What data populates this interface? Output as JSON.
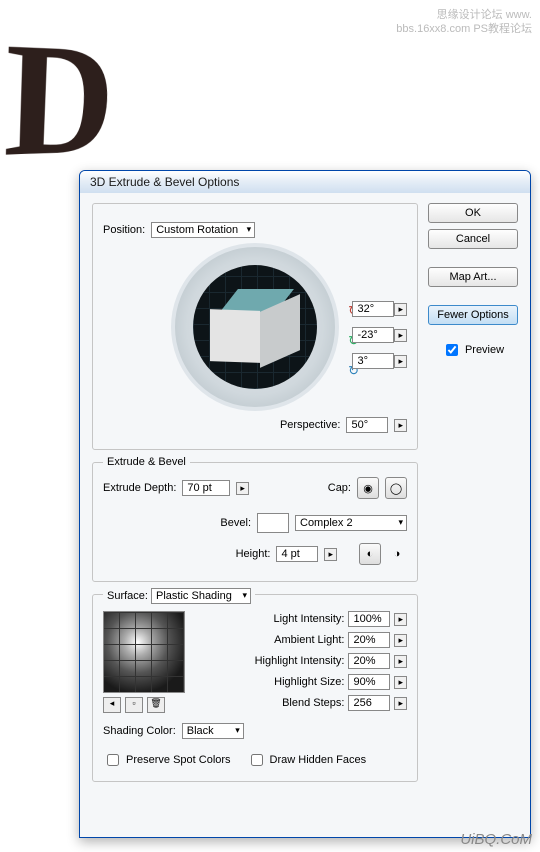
{
  "watermark1": "思缘设计论坛 www.",
  "watermark2": "bbs.16xx8.com PS教程论坛",
  "footer": "UiBQ.CoM",
  "dialog": {
    "title": "3D Extrude & Bevel Options"
  },
  "buttons": {
    "ok": "OK",
    "cancel": "Cancel",
    "mapart": "Map Art...",
    "fewer": "Fewer Options",
    "preview": "Preview"
  },
  "position": {
    "label": "Position:",
    "value": "Custom Rotation",
    "rx": "32°",
    "ry": "-23°",
    "rz": "3°",
    "perspective_label": "Perspective:",
    "perspective": "50°"
  },
  "extrude": {
    "legend": "Extrude & Bevel",
    "depth_label": "Extrude Depth:",
    "depth": "70 pt",
    "cap_label": "Cap:",
    "bevel_label": "Bevel:",
    "bevel": "Complex 2",
    "height_label": "Height:",
    "height": "4 pt"
  },
  "surface": {
    "legend_label": "Surface:",
    "value": "Plastic Shading",
    "light_intensity_label": "Light Intensity:",
    "light_intensity": "100%",
    "ambient_label": "Ambient Light:",
    "ambient": "20%",
    "hl_intensity_label": "Highlight Intensity:",
    "hl_intensity": "20%",
    "hl_size_label": "Highlight Size:",
    "hl_size": "90%",
    "blend_label": "Blend Steps:",
    "blend": "256",
    "shading_label": "Shading Color:",
    "shading": "Black",
    "preserve": "Preserve Spot Colors",
    "hidden": "Draw Hidden Faces"
  }
}
